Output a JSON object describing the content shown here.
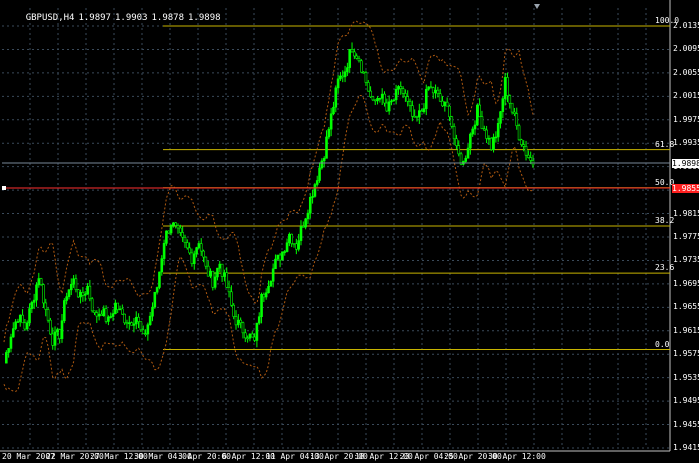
{
  "header": {
    "symbol_tf": "GBPUSD,H4",
    "open": "1.9897",
    "high": "1.9903",
    "low": "1.9878",
    "close": "1.9898"
  },
  "colors": {
    "background": "#000000",
    "grid": "#3a4a5a",
    "candle_up": "#00ff00",
    "fib_level": "#c8b400",
    "bands": "#b05a10",
    "bid_line": "#778899",
    "alert_line": "#ff3030"
  },
  "price_axis": {
    "labels": [
      "2.0135",
      "2.0095",
      "2.0055",
      "2.0015",
      "1.9975",
      "1.9935",
      "1.9898",
      "1.9855",
      "1.9815",
      "1.9775",
      "1.9735",
      "1.9695",
      "1.9655",
      "1.9615",
      "1.9575",
      "1.9535",
      "1.9495",
      "1.9455",
      "1.9415"
    ]
  },
  "time_axis": {
    "labels": [
      "20 Mar 2007",
      "22 Mar 20:00",
      "27 Mar 12:00",
      "30 Mar 04:00",
      "3 Apr 20:00",
      "6 Apr 12:00",
      "11 Apr 04:00",
      "13 Apr 20:00",
      "18 Apr 12:00",
      "23 Apr 04:00",
      "25 Apr 20:00",
      "30 Apr 12:00"
    ]
  },
  "price_markers": {
    "current": "1.9898",
    "alert": "1.9855"
  },
  "fibonacci": {
    "levels": [
      "100.0",
      "61.8",
      "50.0",
      "38.2",
      "23.6",
      "0.0"
    ],
    "high": 2.0135,
    "low": 1.9583
  },
  "chart_data": {
    "type": "line",
    "series": [
      {
        "values": [
          1.956,
          1.961,
          1.964,
          1.962,
          1.966,
          1.971,
          1.965,
          1.96,
          1.961,
          1.968,
          1.97,
          1.967,
          1.969,
          1.964,
          1.965,
          1.963,
          1.966,
          1.964,
          1.963,
          1.964,
          1.96,
          1.964,
          1.969,
          1.977,
          1.98,
          1.978,
          1.976,
          1.974,
          1.977,
          1.972,
          1.97,
          1.973,
          1.969,
          1.964,
          1.962,
          1.961,
          1.9595,
          1.967,
          1.97,
          1.973,
          1.975,
          1.978,
          1.976,
          1.98,
          1.984,
          1.988,
          1.992,
          1.998,
          2.004,
          2.006,
          2.01,
          2.008,
          2.004,
          2.0,
          2.002,
          1.999,
          2.001,
          2.003,
          2.0,
          1.997,
          1.999,
          2.003,
          2.002,
          2.0,
          1.999,
          1.992,
          1.99,
          1.995,
          1.999,
          1.996,
          1.993,
          1.996,
          2.004,
          1.999,
          1.995,
          1.992,
          1.9898
        ]
      }
    ]
  }
}
